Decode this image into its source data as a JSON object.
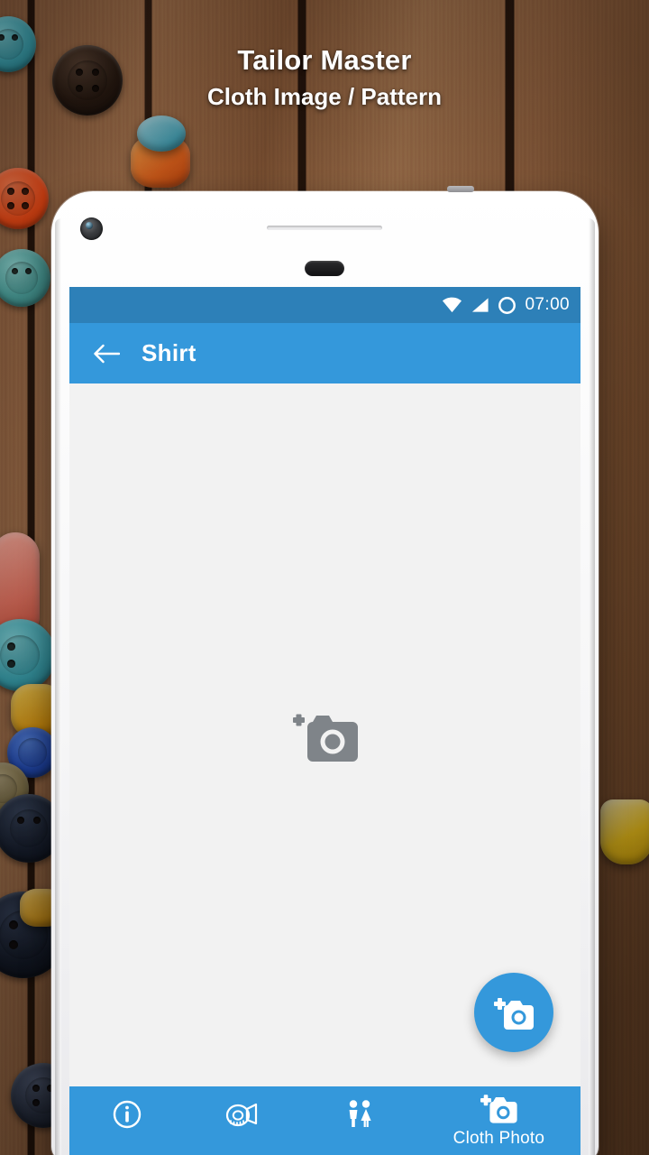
{
  "headline": {
    "title": "Tailor Master",
    "subtitle": "Cloth Image / Pattern"
  },
  "phone": {
    "statusbar": {
      "time": "07:00",
      "icons": [
        "wifi-icon",
        "signal-icon",
        "circle-icon"
      ]
    },
    "appbar": {
      "back_label": "back-arrow-icon",
      "title": "Shirt"
    },
    "content": {
      "placeholder_icon": "add-photo-icon"
    },
    "fab": {
      "icon": "add-photo-icon"
    },
    "bottomnav": {
      "items": [
        {
          "icon": "info-icon",
          "label": ""
        },
        {
          "icon": "measuring-tape-icon",
          "label": ""
        },
        {
          "icon": "people-icon",
          "label": ""
        },
        {
          "icon": "add-photo-icon",
          "label": "Cloth Photo"
        }
      ]
    }
  },
  "colors": {
    "accent": "#3498db",
    "statusbar": "#2d80b8",
    "screen_bg": "#f2f2f2",
    "placeholder_gray": "#7f8489",
    "text_light": "#ffffff"
  }
}
